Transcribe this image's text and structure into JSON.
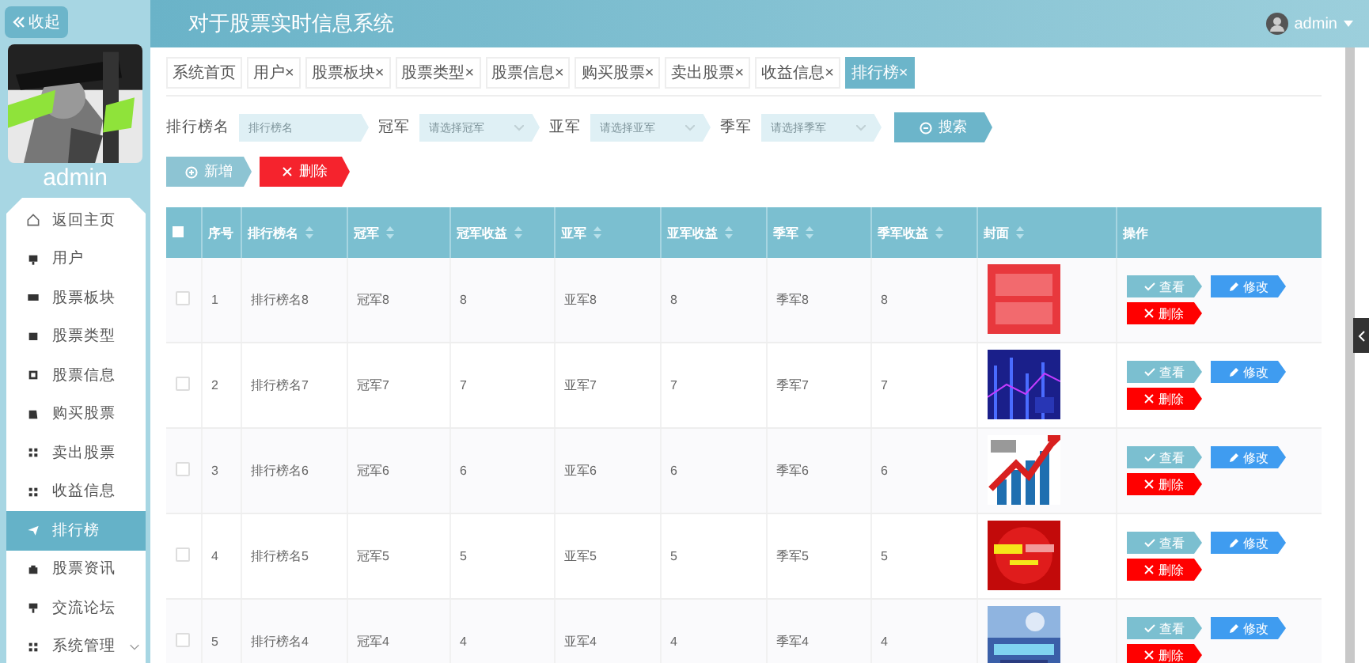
{
  "sidebar": {
    "collapse_label": "收起",
    "user_name": "admin",
    "items": [
      {
        "label": "返回主页",
        "selected": false
      },
      {
        "label": "用户",
        "selected": false
      },
      {
        "label": "股票板块",
        "selected": false
      },
      {
        "label": "股票类型",
        "selected": false
      },
      {
        "label": "股票信息",
        "selected": false
      },
      {
        "label": "购买股票",
        "selected": false
      },
      {
        "label": "卖出股票",
        "selected": false
      },
      {
        "label": "收益信息",
        "selected": false
      },
      {
        "label": "排行榜",
        "selected": true
      },
      {
        "label": "股票资讯",
        "selected": false
      },
      {
        "label": "交流论坛",
        "selected": false
      },
      {
        "label": "系统管理",
        "selected": false,
        "expanded": false
      }
    ]
  },
  "header": {
    "title": "对于股票实时信息系统",
    "user": "admin"
  },
  "tabs": [
    {
      "label": "系统首页",
      "selected": false
    },
    {
      "label": "用户",
      "close": "×",
      "selected": false
    },
    {
      "label": "股票板块",
      "close": "×",
      "selected": false
    },
    {
      "label": "股票类型",
      "close": "×",
      "selected": false
    },
    {
      "label": "股票信息",
      "close": "×",
      "selected": false
    },
    {
      "label": "购买股票",
      "close": "×",
      "selected": false
    },
    {
      "label": "卖出股票",
      "close": "×",
      "selected": false
    },
    {
      "label": "收益信息",
      "close": "×",
      "selected": false
    },
    {
      "label": "排行榜",
      "close": "×",
      "selected": true
    }
  ],
  "search": {
    "fields": [
      {
        "label": "排行榜名",
        "placeholder": "排行榜名",
        "kind": "text"
      },
      {
        "label": "冠军",
        "placeholder": "请选择冠军",
        "kind": "select"
      },
      {
        "label": "亚军",
        "placeholder": "请选择亚军",
        "kind": "select"
      },
      {
        "label": "季军",
        "placeholder": "请选择季军",
        "kind": "select"
      }
    ],
    "button": "搜索"
  },
  "actions": {
    "add": "新增",
    "delete": "删除"
  },
  "table": {
    "all_checked": false,
    "columns": [
      "序号",
      "排行榜名",
      "冠军",
      "冠军收益",
      "亚军",
      "亚军收益",
      "季军",
      "季军收益",
      "封面",
      "操作"
    ],
    "rows": [
      {
        "cells": [
          "1",
          "排行榜名8",
          "冠军8",
          "8",
          "亚军8",
          "8",
          "季军8",
          "8"
        ],
        "checked": false,
        "actions": {
          "view": "查看",
          "edit": "修改",
          "delete": "删除"
        }
      },
      {
        "cells": [
          "2",
          "排行榜名7",
          "冠军7",
          "7",
          "亚军7",
          "7",
          "季军7",
          "7"
        ],
        "checked": false,
        "actions": {
          "view": "查看",
          "edit": "修改",
          "delete": "删除"
        }
      },
      {
        "cells": [
          "3",
          "排行榜名6",
          "冠军6",
          "6",
          "亚军6",
          "6",
          "季军6",
          "6"
        ],
        "checked": false,
        "actions": {
          "view": "查看",
          "edit": "修改",
          "delete": "删除"
        }
      },
      {
        "cells": [
          "4",
          "排行榜名5",
          "冠军5",
          "5",
          "亚军5",
          "5",
          "季军5",
          "5"
        ],
        "checked": false,
        "actions": {
          "view": "查看",
          "edit": "修改",
          "delete": "删除"
        }
      },
      {
        "cells": [
          "5",
          "排行榜名4",
          "冠军4",
          "4",
          "亚军4",
          "4",
          "季军4",
          "4"
        ],
        "checked": false,
        "actions": {
          "view": "查看",
          "edit": "修改",
          "delete": "删除"
        }
      }
    ]
  }
}
